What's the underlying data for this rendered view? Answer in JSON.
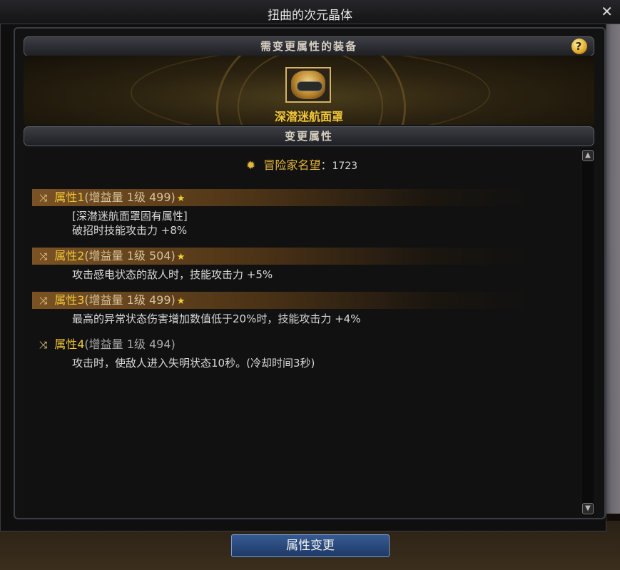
{
  "window": {
    "title": "扭曲的次元晶体",
    "close": "✕"
  },
  "equipment_section": {
    "header": "需变更属性的装备",
    "help": "?",
    "item_name": "深潜迷航面罩"
  },
  "change_section": {
    "header": "变更属性",
    "fame_label": "冒险家名望",
    "fame_sep": "：",
    "fame_value": "1723"
  },
  "attributes": [
    {
      "name": "属性1",
      "level": "(增益量 1级 499)",
      "highlighted": true,
      "lines": [
        "[深潜迷航面罩固有属性]",
        "破招时技能攻击力 +8%"
      ]
    },
    {
      "name": "属性2",
      "level": "(增益量 1级 504)",
      "highlighted": true,
      "lines": [
        "攻击感电状态的敌人时，技能攻击力 +5%"
      ]
    },
    {
      "name": "属性3",
      "level": "(增益量 1级 499)",
      "highlighted": true,
      "lines": [
        "最高的异常状态伤害增加数值低于20%时，技能攻击力 +4%"
      ]
    },
    {
      "name": "属性4",
      "level": "(增益量 1级 494)",
      "highlighted": false,
      "lines": [
        "攻击时，使敌人进入失明状态10秒。(冷却时间3秒)"
      ]
    }
  ],
  "actions": {
    "change_button": "属性变更"
  },
  "icons": {
    "shuffle": "⤨",
    "star": "★",
    "fame": "✹",
    "scroll_up": "▲",
    "scroll_down": "▼"
  },
  "colors": {
    "accent_gold": "#f0c63a",
    "button_blue": "#2a4a80"
  }
}
